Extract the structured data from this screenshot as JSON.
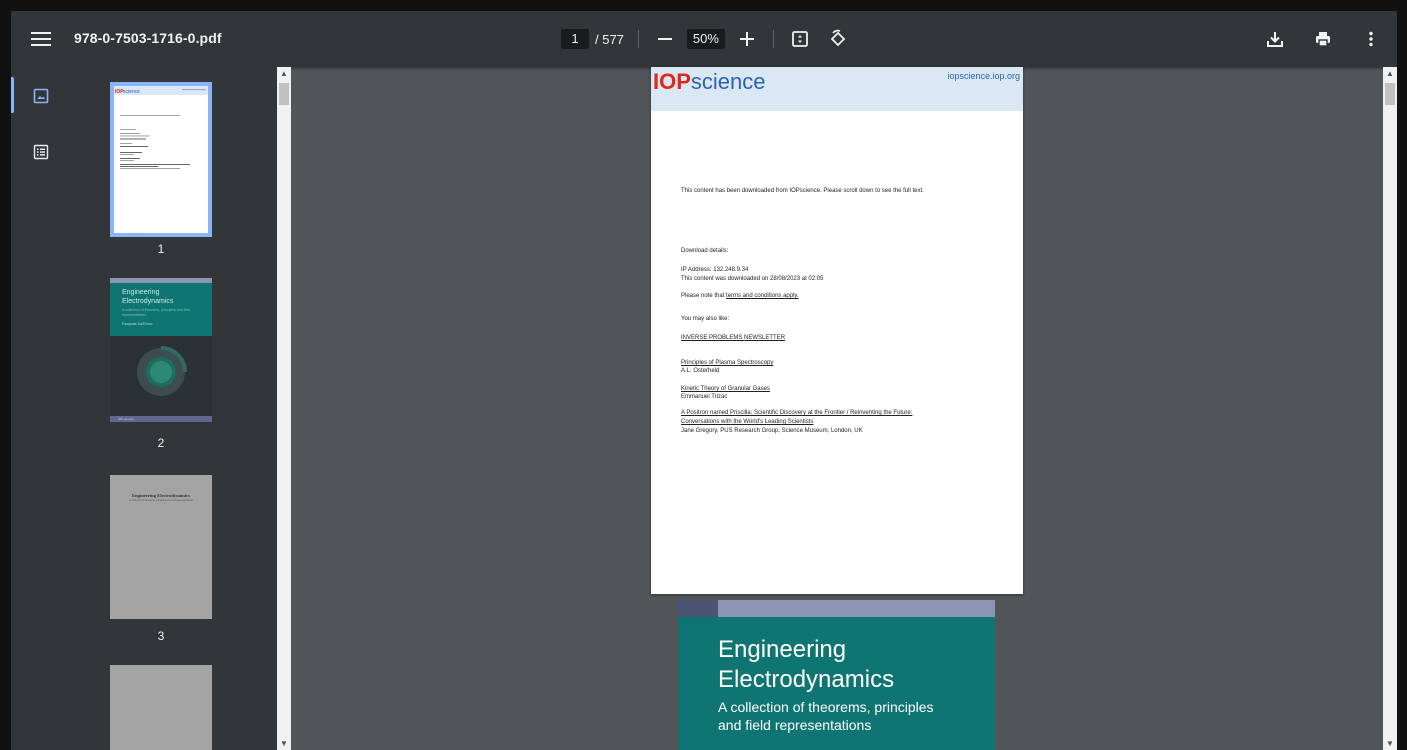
{
  "toolbar": {
    "filename": "978-0-7503-1716-0.pdf",
    "current_page": "1",
    "total_pages": "/ 577",
    "zoom": "50%"
  },
  "sidebar": {
    "thumbnails": [
      {
        "number": "1",
        "selected": true
      },
      {
        "number": "2",
        "selected": false
      },
      {
        "number": "3",
        "selected": false
      }
    ]
  },
  "page1": {
    "logo_iop": "IOP",
    "logo_science": "science",
    "url": "iopscience.iop.org",
    "lines": [
      "This content has been downloaded from IOPscience. Please scroll down to see the full text.",
      "Download details:",
      "IP Address: 132.248.9.34",
      "This content was downloaded on 28/08/2023 at 02:05",
      "Please note that",
      "terms and conditions apply.",
      "You may also like:",
      "INVERSE PROBLEMS NEWSLETTER",
      "Principles of Plasma Spectroscopy",
      "A.L. Osterheld",
      "Kinetic Theory of Granular Gases",
      "Emmanuel Trizac",
      "A Positron named Priscilla: Scientific Discovery at the Frontier / Reinventing the Future:",
      "Conversations with the World's Leading Scientists",
      "Jane Gregory, PUS Research Group, Science Museum, London, UK"
    ]
  },
  "page2": {
    "title_line1": "Engineering",
    "title_line2": "Electrodynamics",
    "subtitle_line1": "A collection of theorems, principles",
    "subtitle_line2": "and field representations"
  },
  "thumb2": {
    "title_line1": "Engineering",
    "title_line2": "Electrodynamics",
    "subtitle": "A collection of theorems, principles and field representations",
    "author": "Pasquale Dall'Osso",
    "footer": "IOP ebooks"
  },
  "thumb3": {
    "title": "Engineering Electrodynamics",
    "subtitle": "A collection of theorems, principles and field representations"
  },
  "colors": {
    "toolbar_bg": "#323639",
    "viewer_bg": "#525659",
    "accent": "#8ab4f8",
    "cover_teal": "#0f7573",
    "iop_red": "#e1261c",
    "iop_blue": "#2a64b0"
  }
}
